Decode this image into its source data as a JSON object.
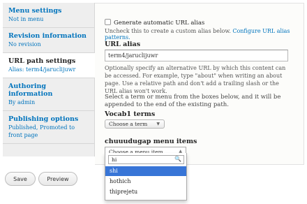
{
  "tabs": [
    {
      "title": "Menu settings",
      "summary": "Not in menu"
    },
    {
      "title": "Revision information",
      "summary": "No revision"
    },
    {
      "title": "URL path settings",
      "summary": "Alias: term4/jaruclijuwr"
    },
    {
      "title": "Authoring information",
      "summary": "By admin"
    },
    {
      "title": "Publishing options",
      "summary": "Published, Promoted to front page"
    }
  ],
  "url": {
    "checkbox_label": "Generate automatic URL alias",
    "checkbox_desc": "Uncheck this to create a custom alias below.",
    "checkbox_link": "Configure URL alias patterns.",
    "alias_label": "URL alias",
    "alias_value": "term4/jaruclijuwr",
    "alias_desc": "Optionally specify an alternative URL by which this content can be accessed. For example, type \"about\" when writing an about page. Use a relative path and don't add a trailing slash or the URL alias won't work.",
    "select_desc": "Select a term or menu from the boxes below, and it will be appended to the end of the existing path.",
    "vocab_label": "Vocab1 terms",
    "vocab_value": "Choose a term",
    "menu_label": "chuuudugap menu items",
    "menu_value": "Choose a menu item",
    "search_value": "hi",
    "options": [
      "shi",
      "hothich",
      "thiprejetu"
    ]
  },
  "buttons": {
    "save": "Save",
    "preview": "Preview"
  }
}
